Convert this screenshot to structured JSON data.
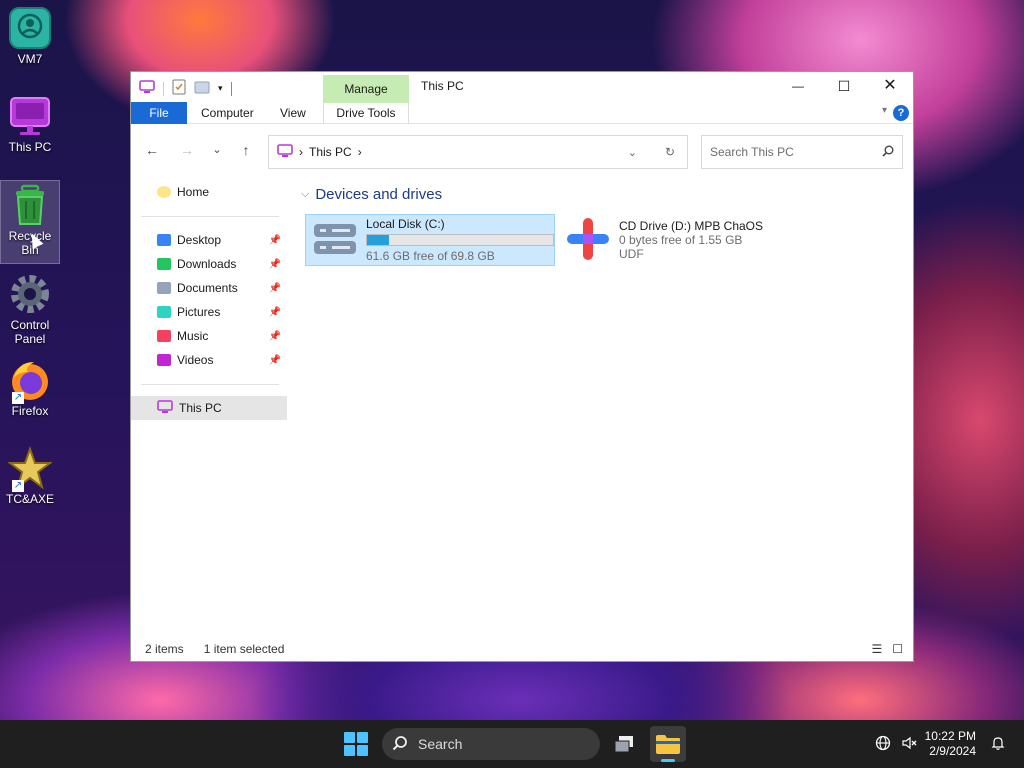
{
  "desktop": {
    "icons": [
      {
        "label_1": "VM7",
        "label_2": ""
      },
      {
        "label_1": "This PC",
        "label_2": ""
      },
      {
        "label_1": "Recycle",
        "label_2": "Bin"
      },
      {
        "label_1": "Control",
        "label_2": "Panel"
      },
      {
        "label_1": "Firefox",
        "label_2": ""
      },
      {
        "label_1": "TC&AXE",
        "label_2": ""
      }
    ]
  },
  "window": {
    "title": "This PC",
    "contextual_tab_group": "Manage",
    "ribbon_tabs": [
      "File",
      "Computer",
      "View",
      "Drive Tools"
    ],
    "help": "?",
    "controls": {
      "minimize": "—",
      "maximize": "☐",
      "close": "✕"
    }
  },
  "address": {
    "path": "This PC",
    "separator": "›"
  },
  "search": {
    "placeholder": "Search This PC"
  },
  "nav_pane": {
    "home": "Home",
    "quick_access": [
      {
        "label": "Desktop",
        "color": "#3b82f6"
      },
      {
        "label": "Downloads",
        "color": "#22c55e"
      },
      {
        "label": "Documents",
        "color": "#94a3b8"
      },
      {
        "label": "Pictures",
        "color": "#2dd4bf"
      },
      {
        "label": "Music",
        "color": "#f43f5e"
      },
      {
        "label": "Videos",
        "color": "#c026d3"
      }
    ],
    "this_pc": "This PC"
  },
  "content": {
    "group_title": "Devices and drives",
    "drives": [
      {
        "name": "Local Disk (C:)",
        "detail": "61.6 GB free of 69.8 GB",
        "used_fraction": 0.117
      },
      {
        "name": "CD Drive (D:) MPB ChaOS",
        "detail": "0 bytes free of 1.55 GB",
        "fs": "UDF"
      }
    ]
  },
  "status": {
    "items": "2 items",
    "selected": "1 item selected"
  },
  "taskbar": {
    "search_label": "Search",
    "time": "10:22 PM",
    "date": "2/9/2024"
  },
  "colors": {
    "accent": "#1a6ad6",
    "manage_tab": "#c7ecb3",
    "selection": "#cce8ff",
    "progress": "#26a0da"
  }
}
